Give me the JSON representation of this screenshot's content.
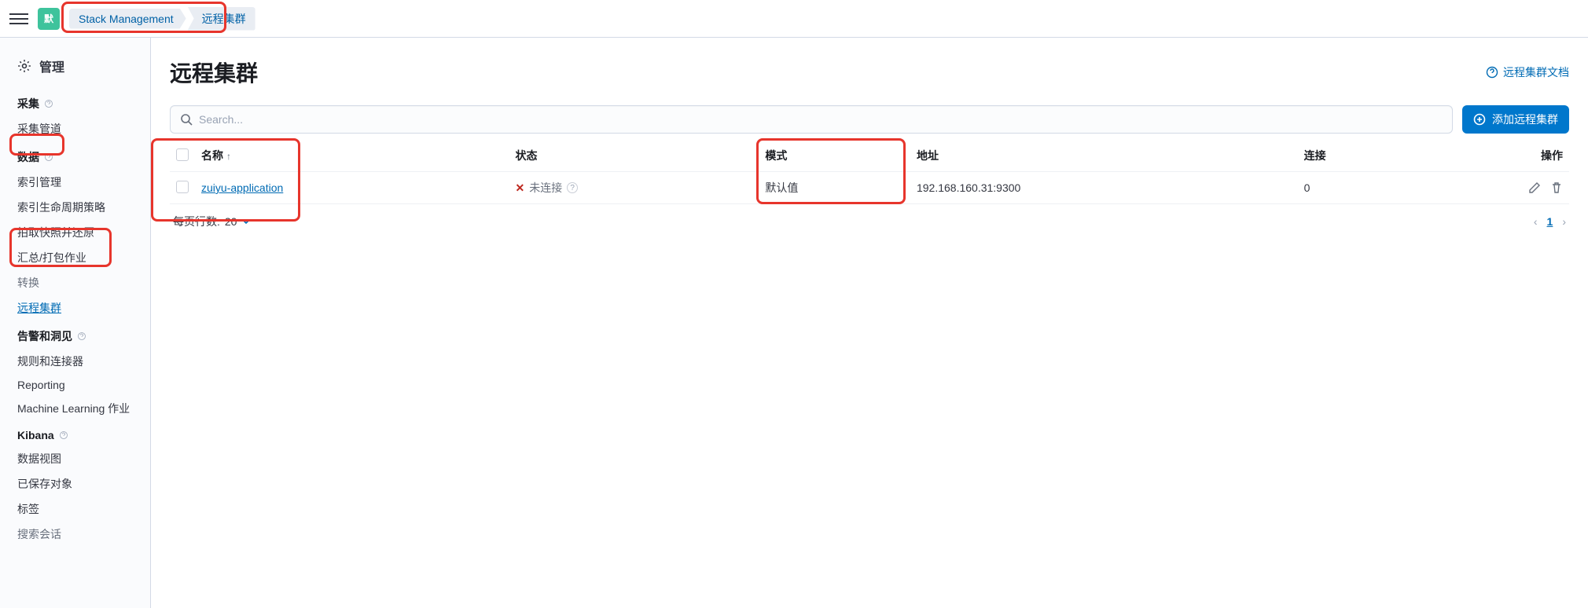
{
  "topbar": {
    "logo_text": "默",
    "breadcrumbs": [
      "Stack Management",
      "远程集群"
    ]
  },
  "sidebar": {
    "header": "管理",
    "groups": [
      {
        "title": "采集",
        "help": true,
        "items": [
          {
            "label": "采集管道",
            "name": "sidebar-item-ingest-pipelines"
          }
        ]
      },
      {
        "title": "数据",
        "help": true,
        "items": [
          {
            "label": "索引管理",
            "name": "sidebar-item-index-management"
          },
          {
            "label": "索引生命周期策略",
            "name": "sidebar-item-ilm"
          },
          {
            "label": "拍取快照并还原",
            "name": "sidebar-item-snapshot-restore"
          },
          {
            "label": "汇总/打包作业",
            "name": "sidebar-item-rollup"
          },
          {
            "label": "转换",
            "name": "sidebar-item-transforms",
            "truncated": true
          },
          {
            "label": "远程集群",
            "name": "sidebar-item-remote-clusters",
            "active": true
          }
        ]
      },
      {
        "title": "告警和洞见",
        "help": true,
        "items": [
          {
            "label": "规则和连接器",
            "name": "sidebar-item-rules-connectors"
          },
          {
            "label": "Reporting",
            "name": "sidebar-item-reporting"
          },
          {
            "label": "Machine Learning 作业",
            "name": "sidebar-item-ml-jobs"
          }
        ]
      },
      {
        "title": "Kibana",
        "help": true,
        "items": [
          {
            "label": "数据视图",
            "name": "sidebar-item-data-views"
          },
          {
            "label": "已保存对象",
            "name": "sidebar-item-saved-objects"
          },
          {
            "label": "标签",
            "name": "sidebar-item-tags"
          },
          {
            "label": "搜索会话",
            "name": "sidebar-item-search-sessions",
            "truncated": true
          }
        ]
      }
    ]
  },
  "page": {
    "title": "远程集群",
    "docs_link": "远程集群文档",
    "search_placeholder": "Search...",
    "add_button": "添加远程集群"
  },
  "table": {
    "columns": {
      "name": "名称",
      "status": "状态",
      "mode": "模式",
      "address": "地址",
      "connections": "连接",
      "actions": "操作"
    },
    "sort_arrow": "↑",
    "rows": [
      {
        "name": "zuiyu-application",
        "status": "未连接",
        "mode": "默认值",
        "address": "192.168.160.31:9300",
        "connections": "0"
      }
    ],
    "rows_per_page_label": "每页行数:",
    "rows_per_page_value": "20",
    "current_page": "1"
  }
}
